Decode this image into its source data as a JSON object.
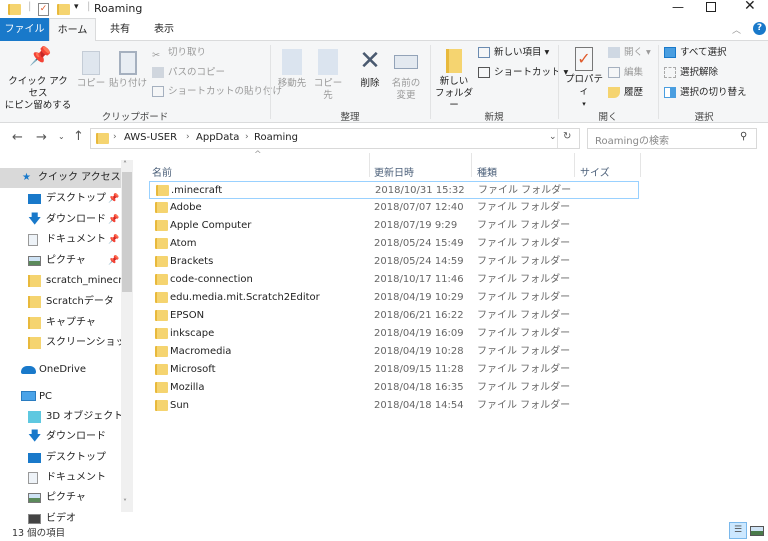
{
  "window": {
    "title": "Roaming",
    "minimize_icon": "minimize-icon",
    "maximize_icon": "maximize-icon",
    "close_icon": "close-icon"
  },
  "tabs": [
    {
      "label": "ファイル"
    },
    {
      "label": "ホーム"
    },
    {
      "label": "共有"
    },
    {
      "label": "表示"
    }
  ],
  "ribbon": {
    "clipboard": {
      "pin": "クイック アクセス",
      "pin2": "にピン留めする",
      "copy": "コピー",
      "paste": "貼り付け",
      "cut": "切り取り",
      "copy_path": "パスのコピー",
      "paste_shortcut": "ショートカットの貼り付け",
      "label": "クリップボード"
    },
    "organize": {
      "move": "移動先",
      "copy_to": "コピー先",
      "delete": "削除",
      "rename1": "名前の",
      "rename2": "変更",
      "label": "整理"
    },
    "new": {
      "new_folder1": "新しい",
      "new_folder2": "フォルダー",
      "new_item": "新しい項目 ▾",
      "shortcut": "ショートカット ▾",
      "label": "新規"
    },
    "open": {
      "properties": "プロパティ",
      "open": "開く ▾",
      "edit": "編集",
      "history": "履歴",
      "label": "開く"
    },
    "select": {
      "select_all": "すべて選択",
      "select_none": "選択解除",
      "invert": "選択の切り替え",
      "label": "選択"
    }
  },
  "address": {
    "path": [
      "AWS-USER",
      "AppData",
      "Roaming"
    ],
    "search_placeholder": "Roamingの検索"
  },
  "columns": {
    "name": "名前",
    "date": "更新日時",
    "type": "種類",
    "size": "サイズ"
  },
  "nav": {
    "quick_access": "クイック アクセス",
    "quick_items": [
      {
        "label": "デスクトップ",
        "pinned": true
      },
      {
        "label": "ダウンロード",
        "pinned": true
      },
      {
        "label": "ドキュメント",
        "pinned": true
      },
      {
        "label": "ピクチャ",
        "pinned": true
      },
      {
        "label": "scratch_minecraft"
      },
      {
        "label": "Scratchデータ"
      },
      {
        "label": "キャプチャ"
      },
      {
        "label": "スクリーンショット"
      }
    ],
    "onedrive": "OneDrive",
    "pc": "PC",
    "pc_items": [
      {
        "label": "3D オブジェクト"
      },
      {
        "label": "ダウンロード"
      },
      {
        "label": "デスクトップ"
      },
      {
        "label": "ドキュメント"
      },
      {
        "label": "ピクチャ"
      },
      {
        "label": "ビデオ"
      }
    ]
  },
  "files": [
    {
      "name": ".minecraft",
      "date": "2018/10/31 15:32",
      "type": "ファイル フォルダー"
    },
    {
      "name": "Adobe",
      "date": "2018/07/07 12:40",
      "type": "ファイル フォルダー"
    },
    {
      "name": "Apple Computer",
      "date": "2018/07/19 9:29",
      "type": "ファイル フォルダー"
    },
    {
      "name": "Atom",
      "date": "2018/05/24 15:49",
      "type": "ファイル フォルダー"
    },
    {
      "name": "Brackets",
      "date": "2018/05/24 14:59",
      "type": "ファイル フォルダー"
    },
    {
      "name": "code-connection",
      "date": "2018/10/17 11:46",
      "type": "ファイル フォルダー"
    },
    {
      "name": "edu.media.mit.Scratch2Editor",
      "date": "2018/04/19 10:29",
      "type": "ファイル フォルダー"
    },
    {
      "name": "EPSON",
      "date": "2018/06/21 16:22",
      "type": "ファイル フォルダー"
    },
    {
      "name": "inkscape",
      "date": "2018/04/19 16:09",
      "type": "ファイル フォルダー"
    },
    {
      "name": "Macromedia",
      "date": "2018/04/19 10:28",
      "type": "ファイル フォルダー"
    },
    {
      "name": "Microsoft",
      "date": "2018/09/15 11:28",
      "type": "ファイル フォルダー"
    },
    {
      "name": "Mozilla",
      "date": "2018/04/18 16:35",
      "type": "ファイル フォルダー"
    },
    {
      "name": "Sun",
      "date": "2018/04/18 14:54",
      "type": "ファイル フォルダー"
    }
  ],
  "status": {
    "count": "13 個の項目"
  },
  "colors": {
    "accent": "#1979ca",
    "selection": "#cce8ff",
    "folder": "#f5d470"
  }
}
